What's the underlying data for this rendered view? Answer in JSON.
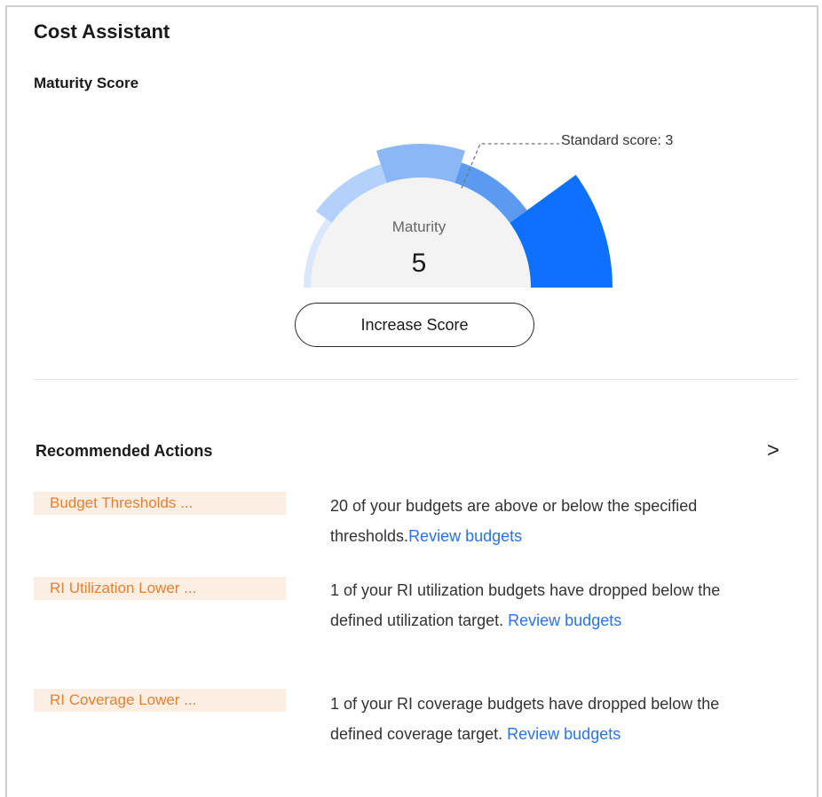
{
  "header": {
    "title": "Cost Assistant",
    "subtitle": "Maturity Score"
  },
  "gauge": {
    "caption": "Maturity",
    "value": "5",
    "standard_label": "Standard score: 3",
    "segment_colors": [
      "#dbe8fb",
      "#b3d1fa",
      "#8bb7f6",
      "#5a9af1",
      "#0d70ff"
    ]
  },
  "actions": {
    "increase_label": "Increase Score"
  },
  "recommended": {
    "title": "Recommended Actions",
    "chevron": ">",
    "items": [
      {
        "tag": "Budget Thresholds ...",
        "text": "20 of your budgets are above or below the specified thresholds.",
        "link": "Review budgets"
      },
      {
        "tag": "RI Utilization Lower ...",
        "text": "1 of your RI utilization budgets have dropped below the defined utilization target. ",
        "link": "Review budgets"
      },
      {
        "tag": "RI Coverage Lower ...",
        "text": "1 of your RI coverage budgets have dropped below the defined coverage target. ",
        "link": "Review budgets"
      }
    ]
  }
}
